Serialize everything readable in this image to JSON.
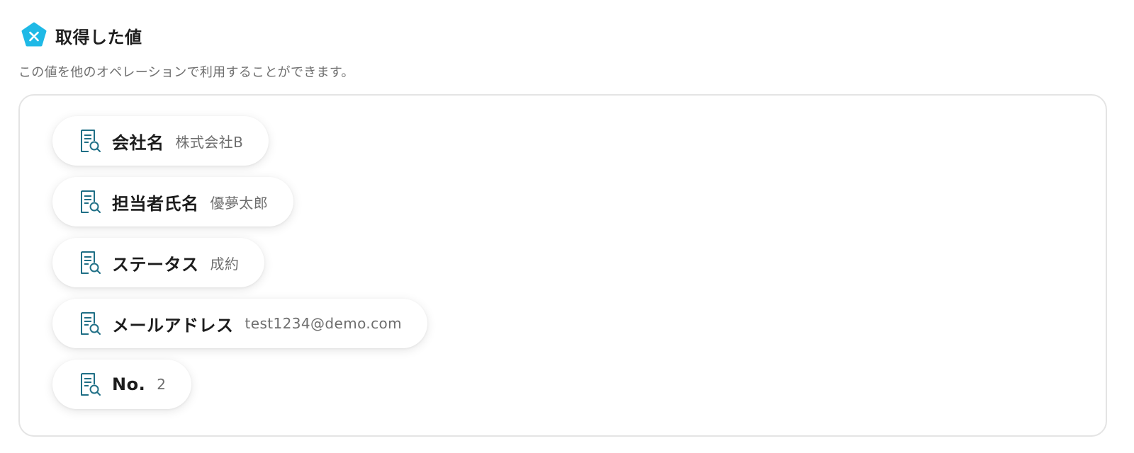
{
  "header": {
    "title": "取得した値",
    "subtitle": "この値を他のオペレーションで利用することができます。",
    "logo_icon": "x-pentagon-icon",
    "logo_color": "#1fb9e6"
  },
  "fields": [
    {
      "label": "会社名",
      "value": "株式会社B",
      "icon": "document-search-icon"
    },
    {
      "label": "担当者氏名",
      "value": "優夢太郎",
      "icon": "document-search-icon"
    },
    {
      "label": "ステータス",
      "value": "成約",
      "icon": "document-search-icon"
    },
    {
      "label": "メールアドレス",
      "value": "test1234@demo.com",
      "icon": "document-search-icon"
    },
    {
      "label": "No.",
      "value": "2",
      "icon": "document-search-icon"
    }
  ],
  "colors": {
    "icon_stroke": "#1f6f86",
    "border": "#e4e4e4",
    "value_text": "#6e6e6e"
  }
}
